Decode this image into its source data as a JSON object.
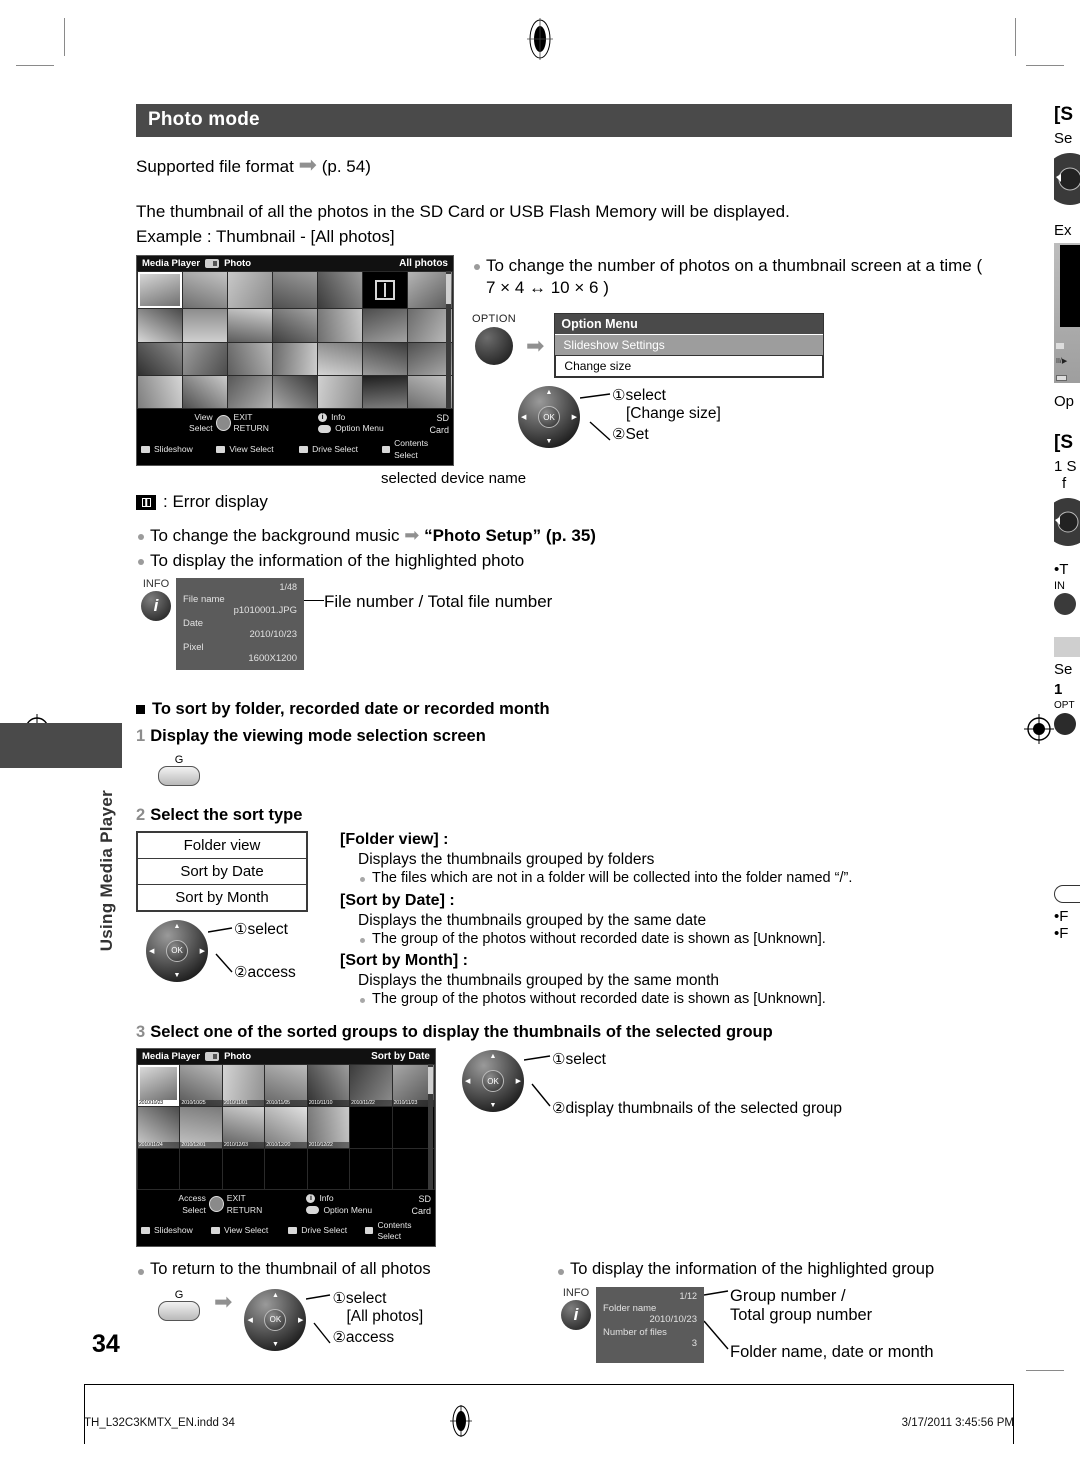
{
  "section": {
    "title": "Photo mode"
  },
  "intro": {
    "supported": "Supported file format",
    "supported_page": "(p. 54)",
    "line1": "The thumbnail of all the photos in the SD Card or USB Flash Memory will be displayed.",
    "line2": "Example : Thumbnail - [All photos]"
  },
  "tv_all": {
    "header_left": "Media Player",
    "header_mode": "Photo",
    "header_right": "All photos",
    "footer": {
      "view": "View",
      "select": "Select",
      "exit": "EXIT",
      "return": "RETURN",
      "info": "Info",
      "option_menu": "Option Menu",
      "slideshow": "Slideshow",
      "view_select": "View Select",
      "drive_select": "Drive Select",
      "contents_select": "Contents Select",
      "device": "SD Card"
    }
  },
  "option_note": {
    "bullet": "To change the number of photos on a thumbnail screen at a time ( 7 × 4 ↔ 10 × 6 )",
    "button_label": "OPTION",
    "menu_title": "Option Menu",
    "menu_item_1": "Slideshow Settings",
    "menu_item_2": "Change size",
    "step1": "select",
    "step1_value": "[Change size]",
    "step2": "Set",
    "num1": "①",
    "num2": "②"
  },
  "callouts": {
    "selected_device_name": "selected device name",
    "error_display": ": Error display",
    "bg_music": "To change the background music",
    "bg_music_ref": "“Photo Setup” (p. 35)",
    "info_photo": "To display the information of the highlighted photo",
    "file_number_caption": "File number / Total file number"
  },
  "info_photo_panel": {
    "label": "INFO",
    "count": "1/48",
    "k1": "File name",
    "v1": "p1010001.JPG",
    "k2": "Date",
    "v2": "2010/10/23",
    "k3": "Pixel",
    "v3": "1600X1200"
  },
  "sort_section": {
    "heading": "To sort by folder, recorded date or recorded month",
    "step1_num": "1",
    "step1": "Display the viewing mode selection screen",
    "button_g": "G",
    "step2_num": "2",
    "step2": "Select the sort type",
    "options": [
      "Folder view",
      "Sort by Date",
      "Sort by Month"
    ],
    "pad_step1": "select",
    "pad_step2": "access",
    "num1": "①",
    "num2": "②",
    "defs": [
      {
        "term": "[Folder view] :",
        "desc": "Displays the thumbnails grouped by folders",
        "note": "The files which are not in a folder will be collected into the folder named “/”."
      },
      {
        "term": "[Sort by Date] :",
        "desc": "Displays the thumbnails grouped by the same date",
        "note": "The group of the photos without recorded date is shown as [Unknown]."
      },
      {
        "term": "[Sort by Month] :",
        "desc": "Displays the thumbnails grouped by the same month",
        "note": "The group of the photos without recorded date is shown as [Unknown]."
      }
    ],
    "step3_num": "3",
    "step3": "Select one of the sorted groups to display the thumbnails of the selected group"
  },
  "tv_sorted": {
    "header_left": "Media Player",
    "header_mode": "Photo",
    "header_right": "Sort by Date",
    "dates": [
      "2010/10/23",
      "2010/10/25",
      "2010/11/01",
      "2010/11/05",
      "2010/11/10",
      "2010/11/22",
      "2010/11/23",
      "2010/11/24",
      "2010/12/01",
      "2010/12/03",
      "2010/12/20",
      "2010/12/22"
    ],
    "footer": {
      "access": "Access",
      "select": "Select",
      "exit": "EXIT",
      "return": "RETURN",
      "info": "Info",
      "option_menu": "Option Menu",
      "slideshow": "Slideshow",
      "view_select": "View Select",
      "drive_select": "Drive Select",
      "contents_select": "Contents Select",
      "device": "SD Card"
    },
    "pad_step1": "select",
    "pad_step2": "display thumbnails of the selected group",
    "num1": "①",
    "num2": "②"
  },
  "return_all": {
    "bullet": "To return to the thumbnail of all photos",
    "button_g": "G",
    "step1": "select",
    "step1_value": "[All photos]",
    "step2": "access",
    "num1": "①",
    "num2": "②"
  },
  "group_info": {
    "bullet": "To display the information of the highlighted group",
    "label": "INFO",
    "count": "1/12",
    "k1": "Folder name",
    "v1": "2010/10/23",
    "k2": "Number of files",
    "v2": "3",
    "caption1": "Group number /",
    "caption2": "Total group number",
    "caption3": "Folder name, date or month"
  },
  "sidebar": {
    "label": "Using Media Player"
  },
  "right_column": {
    "l1": "[S",
    "l2": "Se",
    "l3": "Ex",
    "l4": "Op",
    "l5": "[S",
    "l6": "1 S",
    "l7": "f",
    "l8": "T",
    "l9": "IN",
    "l10": "Se",
    "l11": "1 ",
    "l12": "OPT",
    "l13": "F",
    "l14": "F"
  },
  "footer": {
    "page": "34",
    "file": "TH_L32C3KMTX_EN.indd   34",
    "date": "3/17/2011   3:45:56 PM"
  },
  "colors": {
    "section_bar": "#4a4a4a",
    "tv_bg": "#000000",
    "panel_gray": "#5b5b5b",
    "accent_num": "#8c8c8c"
  }
}
